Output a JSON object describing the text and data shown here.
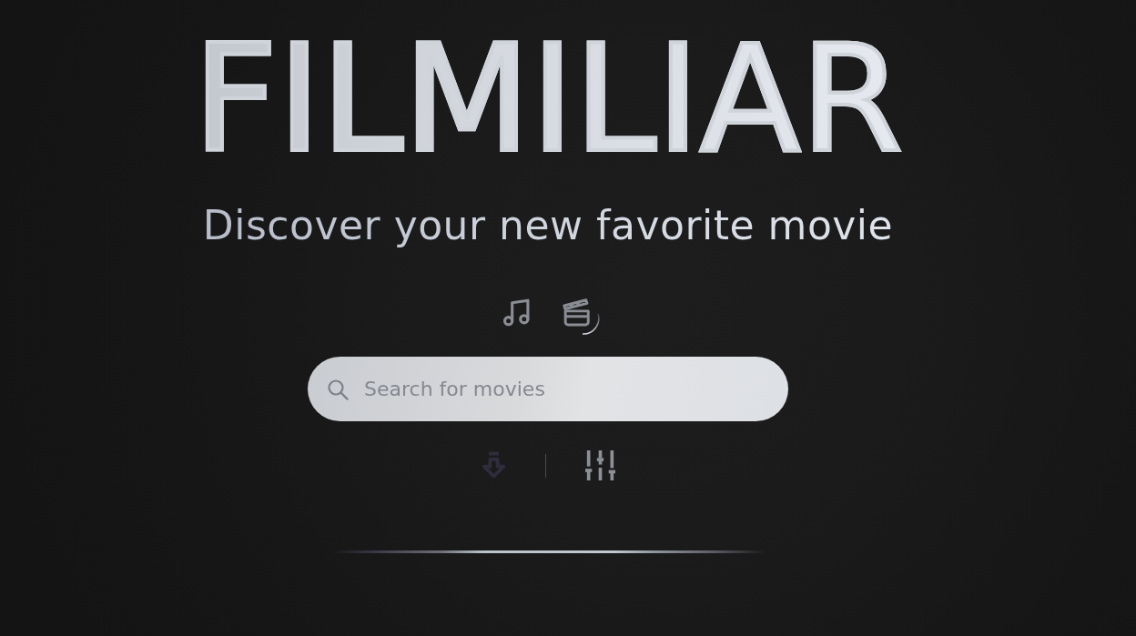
{
  "title": "FILMILIAR",
  "tagline": "Discover your new favorite movie",
  "modes": [
    {
      "kind": "music",
      "selected": false
    },
    {
      "kind": "film",
      "selected": true
    }
  ],
  "search": {
    "placeholder": "Search for movies"
  },
  "actions": [
    {
      "kind": "download",
      "disabled": true
    },
    {
      "kind": "filters",
      "disabled": false
    }
  ]
}
